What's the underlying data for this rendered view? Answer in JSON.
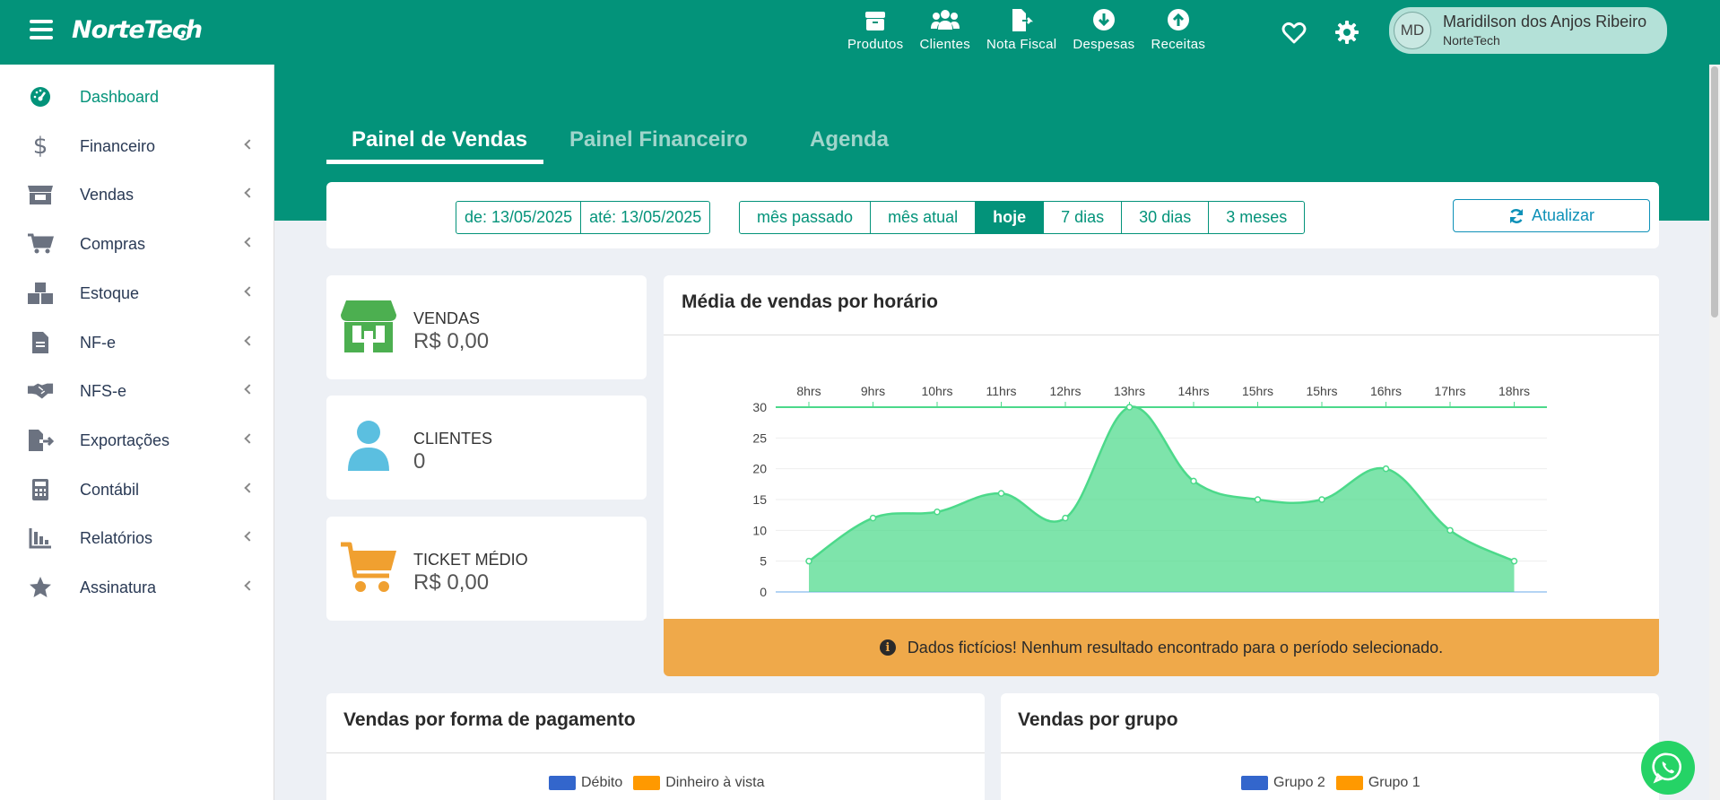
{
  "brand": {
    "name": "NorteTech"
  },
  "top_nav": [
    {
      "id": "produtos",
      "label": "Produtos"
    },
    {
      "id": "clientes",
      "label": "Clientes"
    },
    {
      "id": "nota_fiscal",
      "label": "Nota Fiscal"
    },
    {
      "id": "despesas",
      "label": "Despesas"
    },
    {
      "id": "receitas",
      "label": "Receitas"
    }
  ],
  "user": {
    "initials": "MD",
    "name": "Maridilson dos Anjos Ribeiro",
    "company": "NorteTech"
  },
  "sidebar": {
    "items": [
      {
        "label": "Dashboard",
        "icon": "tachometer-icon",
        "active": true
      },
      {
        "label": "Financeiro",
        "icon": "dollar-icon"
      },
      {
        "label": "Vendas",
        "icon": "store-icon"
      },
      {
        "label": "Compras",
        "icon": "cart-icon"
      },
      {
        "label": "Estoque",
        "icon": "boxes-icon"
      },
      {
        "label": "NF-e",
        "icon": "file-icon"
      },
      {
        "label": "NFS-e",
        "icon": "handshake-icon"
      },
      {
        "label": "Exportações",
        "icon": "file-export-icon"
      },
      {
        "label": "Contábil",
        "icon": "calculator-icon"
      },
      {
        "label": "Relatórios",
        "icon": "chart-bar-icon"
      },
      {
        "label": "Assinatura",
        "icon": "star-icon"
      }
    ]
  },
  "tabs": [
    {
      "label": "Painel de Vendas",
      "active": true
    },
    {
      "label": "Painel Financeiro"
    },
    {
      "label": "Agenda"
    }
  ],
  "filters": {
    "date_from": "de: 13/05/2025",
    "date_to": "até: 13/05/2025",
    "ranges": [
      "mês passado",
      "mês atual",
      "hoje",
      "7 dias",
      "30 dias",
      "3 meses"
    ],
    "selected_range": "hoje",
    "refresh_label": "Atualizar"
  },
  "stats": {
    "vendas": {
      "label": "VENDAS",
      "value": "R$  0,00",
      "color": "#4caf50"
    },
    "clientes": {
      "label": "CLIENTES",
      "value": "0",
      "color": "#5bbfe0"
    },
    "ticket": {
      "label": "TICKET MÉDIO",
      "value": "R$  0,00",
      "color": "#f0a030"
    }
  },
  "chart": {
    "title": "Média de vendas por horário",
    "warning": "Dados fictícios! Nenhum resultado encontrado para o período selecionado."
  },
  "chart_data": {
    "type": "area",
    "categories": [
      "8hrs",
      "9hrs",
      "10hrs",
      "11hrs",
      "12hrs",
      "13hrs",
      "14hrs",
      "15hrs",
      "15hrs",
      "16hrs",
      "17hrs",
      "18hrs"
    ],
    "values": [
      5,
      12,
      13,
      16,
      12,
      30,
      18,
      15,
      15,
      20,
      10,
      5
    ],
    "ylim": [
      0,
      30
    ],
    "yticks": [
      0,
      5,
      10,
      15,
      20,
      25,
      30
    ],
    "color": "#4cd98a"
  },
  "payment_card": {
    "title": "Vendas por forma de pagamento",
    "legend": [
      {
        "label": "Débito",
        "color": "#3366cc"
      },
      {
        "label": "Dinheiro à vista",
        "color": "#ff9900"
      }
    ]
  },
  "group_card": {
    "title": "Vendas por grupo",
    "legend": [
      {
        "label": "Grupo 2",
        "color": "#3366cc"
      },
      {
        "label": "Grupo 1",
        "color": "#ff9900"
      }
    ]
  }
}
